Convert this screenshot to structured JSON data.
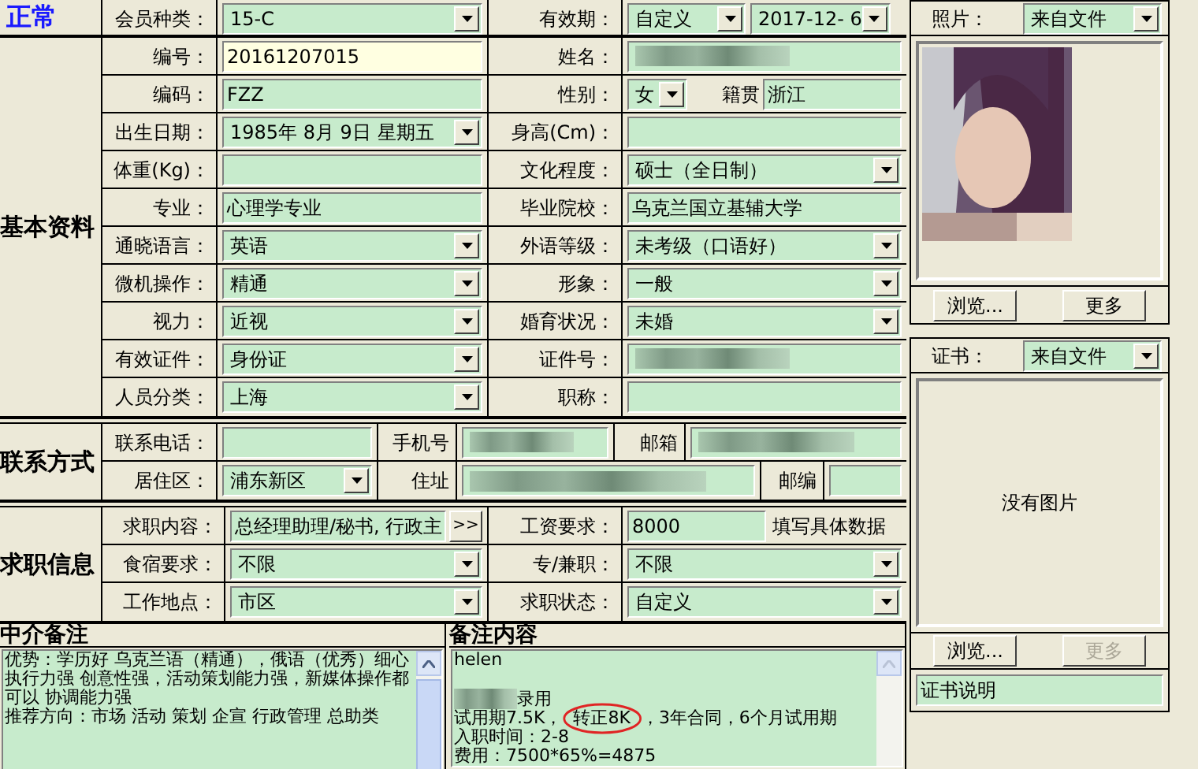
{
  "status": "正常",
  "header": {
    "left": {
      "label": "会员种类：",
      "kind": "dropdown",
      "value": "15-C"
    },
    "right": {
      "label": "有效期：",
      "kind": "validity",
      "value": "自定义",
      "date": "2017-12- 6"
    }
  },
  "basic": {
    "title": "基本资料",
    "rows": [
      {
        "left": {
          "label": "编号：",
          "kind": "readonly",
          "value": "20161207015"
        },
        "right": {
          "label": "姓名：",
          "kind": "text",
          "redacted": true
        }
      },
      {
        "left": {
          "label": "编码：",
          "kind": "text",
          "value": "FZZ"
        },
        "right": {
          "label": "性别：",
          "kind": "gender",
          "value": "女",
          "extra_label": "籍贯",
          "extra_value": "浙江"
        }
      },
      {
        "left": {
          "label": "出生日期：",
          "kind": "dropdown",
          "value": "1985年 8月 9日 星期五"
        },
        "right": {
          "label": "身高(Cm)：",
          "kind": "text"
        }
      },
      {
        "left": {
          "label": "体重(Kg)：",
          "kind": "text"
        },
        "right": {
          "label": "文化程度：",
          "kind": "dropdown",
          "value": "硕士（全日制）"
        }
      },
      {
        "left": {
          "label": "专业：",
          "kind": "text",
          "value": "心理学专业"
        },
        "right": {
          "label": "毕业院校：",
          "kind": "text",
          "value": "乌克兰国立基辅大学"
        }
      },
      {
        "left": {
          "label": "通晓语言：",
          "kind": "dropdown",
          "value": "英语"
        },
        "right": {
          "label": "外语等级：",
          "kind": "dropdown",
          "value": "未考级（口语好）"
        }
      },
      {
        "left": {
          "label": "微机操作：",
          "kind": "dropdown",
          "value": "精通"
        },
        "right": {
          "label": "形象：",
          "kind": "dropdown",
          "value": "一般"
        }
      },
      {
        "left": {
          "label": "视力：",
          "kind": "dropdown",
          "value": "近视"
        },
        "right": {
          "label": "婚育状况：",
          "kind": "dropdown",
          "value": "未婚"
        }
      },
      {
        "left": {
          "label": "有效证件：",
          "kind": "dropdown",
          "value": "身份证"
        },
        "right": {
          "label": "证件号：",
          "kind": "text",
          "redacted": true
        }
      },
      {
        "left": {
          "label": "人员分类：",
          "kind": "dropdown",
          "value": "上海"
        },
        "right": {
          "label": "职称：",
          "kind": "text"
        }
      }
    ]
  },
  "contact": {
    "title": "联系方式",
    "rows": [
      [
        {
          "label": "联系电话：",
          "kind": "text"
        },
        {
          "label": "手机号",
          "kind": "text",
          "redacted": true
        },
        {
          "label": "邮箱",
          "kind": "text",
          "redacted": true
        }
      ],
      [
        {
          "label": "居住区：",
          "kind": "dropdown",
          "value": "浦东新区"
        },
        {
          "label": "住址",
          "kind": "text",
          "redacted": true
        },
        {
          "label": "邮编",
          "kind": "text"
        }
      ]
    ]
  },
  "job": {
    "title": "求职信息",
    "rows": [
      {
        "left": {
          "label": "求职内容：",
          "kind": "more",
          "value": "总经理助理/秘书, 行政主",
          "button": ">>"
        },
        "right": {
          "label": "工资要求：",
          "kind": "hint",
          "value": "8000",
          "hint": "填写具体数据"
        }
      },
      {
        "left": {
          "label": "食宿要求：",
          "kind": "dropdown",
          "value": "不限"
        },
        "right": {
          "label": "专/兼职：",
          "kind": "dropdown",
          "value": "不限"
        }
      },
      {
        "left": {
          "label": "工作地点：",
          "kind": "dropdown",
          "value": "市区"
        },
        "right": {
          "label": "求职状态：",
          "kind": "dropdown",
          "value": "自定义"
        }
      }
    ]
  },
  "agency_notes": {
    "title": "中介备注",
    "lines": [
      {
        "kind": "text",
        "text": "优势：学历好 乌克兰语（精通），俄语（优秀）细心执行力强 创意性强，活动策划能力强，新媒体操作都可以  协调能力强"
      },
      {
        "kind": "text",
        "text": "推荐方向：市场 活动 策划 企宣 行政管理 总助类"
      }
    ]
  },
  "remarks": {
    "title": "备注内容",
    "lines": [
      {
        "kind": "text",
        "text": "helen"
      },
      {
        "kind": "blank"
      },
      {
        "kind": "text",
        "text": "录用",
        "redacted": true
      },
      {
        "kind": "circled",
        "before": "试用期7.5K，",
        "circled": "转正8K",
        "after": "，3年合同，6个月试用期"
      },
      {
        "kind": "text",
        "text": "入职时间：2-8"
      },
      {
        "kind": "text",
        "text": "费用：7500*65%=4875"
      }
    ]
  },
  "photo": {
    "label": "照片：",
    "source": "来自文件",
    "buttons": [
      {
        "label": "浏览...",
        "disabled": false
      },
      {
        "label": "更多",
        "disabled": false
      }
    ]
  },
  "certificate": {
    "label": "证书：",
    "source": "来自文件",
    "empty_text": "没有图片",
    "buttons": [
      {
        "label": "浏览...",
        "disabled": false
      },
      {
        "label": "更多",
        "disabled": true
      }
    ],
    "caption": "证书说明"
  }
}
